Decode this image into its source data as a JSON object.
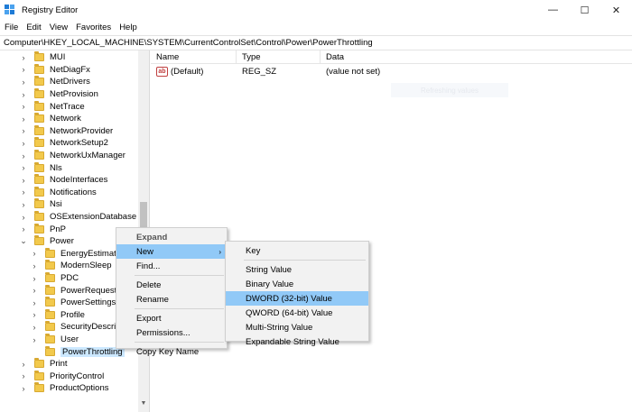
{
  "window": {
    "title": "Registry Editor",
    "controls": {
      "minimize": "—",
      "maximize": "☐",
      "close": "✕"
    }
  },
  "menubar": [
    "File",
    "Edit",
    "View",
    "Favorites",
    "Help"
  ],
  "address": "Computer\\HKEY_LOCAL_MACHINE\\SYSTEM\\CurrentControlSet\\Control\\Power\\PowerThrottling",
  "tree": [
    {
      "label": "MUI",
      "expander": "›",
      "level": 0
    },
    {
      "label": "NetDiagFx",
      "expander": "›",
      "level": 0
    },
    {
      "label": "NetDrivers",
      "expander": "›",
      "level": 0
    },
    {
      "label": "NetProvision",
      "expander": "›",
      "level": 0
    },
    {
      "label": "NetTrace",
      "expander": "›",
      "level": 0
    },
    {
      "label": "Network",
      "expander": "›",
      "level": 0
    },
    {
      "label": "NetworkProvider",
      "expander": "›",
      "level": 0
    },
    {
      "label": "NetworkSetup2",
      "expander": "›",
      "level": 0
    },
    {
      "label": "NetworkUxManager",
      "expander": "›",
      "level": 0
    },
    {
      "label": "Nls",
      "expander": "›",
      "level": 0
    },
    {
      "label": "NodeInterfaces",
      "expander": "›",
      "level": 0
    },
    {
      "label": "Notifications",
      "expander": "›",
      "level": 0
    },
    {
      "label": "Nsi",
      "expander": "›",
      "level": 0
    },
    {
      "label": "OSExtensionDatabase",
      "expander": "›",
      "level": 0
    },
    {
      "label": "PnP",
      "expander": "›",
      "level": 0
    },
    {
      "label": "Power",
      "expander": "⌄",
      "level": 0
    },
    {
      "label": "EnergyEstimation",
      "expander": "›",
      "level": 1
    },
    {
      "label": "ModernSleep",
      "expander": "›",
      "level": 1
    },
    {
      "label": "PDC",
      "expander": "›",
      "level": 1
    },
    {
      "label": "PowerRequestOv",
      "expander": "›",
      "level": 1
    },
    {
      "label": "PowerSettings",
      "expander": "›",
      "level": 1
    },
    {
      "label": "Profile",
      "expander": "›",
      "level": 1
    },
    {
      "label": "SecurityDescripto",
      "expander": "›",
      "level": 1
    },
    {
      "label": "User",
      "expander": "›",
      "level": 1
    },
    {
      "label": "PowerThrottling",
      "expander": "",
      "level": 1,
      "selected": true
    },
    {
      "label": "Print",
      "expander": "›",
      "level": 0
    },
    {
      "label": "PriorityControl",
      "expander": "›",
      "level": 0
    },
    {
      "label": "ProductOptions",
      "expander": "›",
      "level": 0
    }
  ],
  "list": {
    "columns": [
      "Name",
      "Type",
      "Data"
    ],
    "rows": [
      {
        "name": "(Default)",
        "type": "REG_SZ",
        "data": "(value not set)",
        "icon": "ab"
      }
    ],
    "ghost_text": "Refreshing values"
  },
  "context_menu": {
    "items": [
      {
        "label": "Expand",
        "bold": true
      },
      {
        "label": "New",
        "submenu": true,
        "highlighted": true
      },
      {
        "label": "Find..."
      },
      {
        "sep": true
      },
      {
        "label": "Delete"
      },
      {
        "label": "Rename"
      },
      {
        "sep": true
      },
      {
        "label": "Export"
      },
      {
        "label": "Permissions..."
      },
      {
        "sep": true
      },
      {
        "label": "Copy Key Name"
      }
    ]
  },
  "submenu": {
    "items": [
      {
        "label": "Key"
      },
      {
        "sep": true
      },
      {
        "label": "String Value"
      },
      {
        "label": "Binary Value"
      },
      {
        "label": "DWORD (32-bit) Value",
        "highlighted": true
      },
      {
        "label": "QWORD (64-bit) Value"
      },
      {
        "label": "Multi-String Value"
      },
      {
        "label": "Expandable String Value"
      }
    ]
  },
  "colors": {
    "selection": "#cce8ff",
    "menu_highlight": "#91c9f7",
    "menu_bg": "#f2f2f2",
    "folder": "#f2c94c"
  }
}
